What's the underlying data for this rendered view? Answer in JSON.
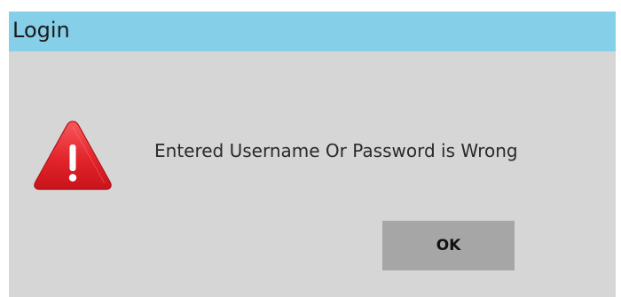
{
  "window": {
    "title": "Login"
  },
  "dialog": {
    "icon": "warning-triangle-icon",
    "message": "Entered Username Or Password is Wrong",
    "ok_label": "OK"
  },
  "colors": {
    "titlebar": "#86cfe9",
    "body": "#d6d6d6",
    "button": "#a6a6a6",
    "warning_red": "#e3242b"
  }
}
